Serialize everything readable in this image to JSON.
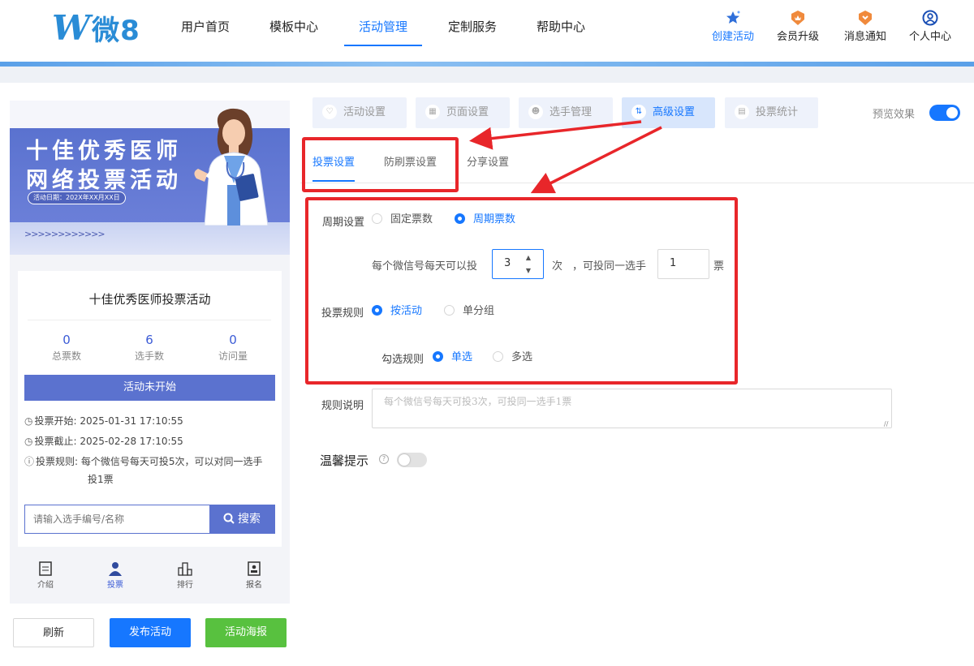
{
  "logo": {
    "mark": "W",
    "text": "微8"
  },
  "nav": [
    {
      "label": "用户首页"
    },
    {
      "label": "模板中心"
    },
    {
      "label": "活动管理",
      "active": true
    },
    {
      "label": "定制服务"
    },
    {
      "label": "帮助中心"
    }
  ],
  "tools": [
    {
      "label": "创建活动",
      "icon": "star-sparkle-icon"
    },
    {
      "label": "会员升级",
      "icon": "crown-badge-icon"
    },
    {
      "label": "消息通知",
      "icon": "bell-badge-icon"
    },
    {
      "label": "个人中心",
      "icon": "user-circle-icon"
    }
  ],
  "preview": {
    "banner_line1": "十佳优秀医师",
    "banner_line2": "网络投票活动",
    "banner_date": "活动日期：202X年XX月XX日",
    "banner_arrows": ">>>>>>>>>>>>",
    "title": "十佳优秀医师投票活动",
    "stats": [
      {
        "value": "0",
        "label": "总票数"
      },
      {
        "value": "6",
        "label": "选手数"
      },
      {
        "value": "0",
        "label": "访问量"
      }
    ],
    "status": "活动未开始",
    "start_label": "投票开始:",
    "start_value": "2025-01-31 17:10:55",
    "end_label": "投票截止:",
    "end_value": "2025-02-28 17:10:55",
    "rule_label": "投票规则:",
    "rule_value_line1": "每个微信号每天可投5次，可以对同一选手",
    "rule_value_line2": "投1票",
    "search_placeholder": "请输入选手编号/名称",
    "search_button": "搜索",
    "tabbar": [
      {
        "label": "介绍",
        "icon": "document-icon"
      },
      {
        "label": "投票",
        "icon": "person-icon",
        "active": true
      },
      {
        "label": "排行",
        "icon": "bar-chart-icon"
      },
      {
        "label": "报名",
        "icon": "id-card-icon"
      }
    ]
  },
  "actions": {
    "refresh": "刷新",
    "publish": "发布活动",
    "poster": "活动海报"
  },
  "steps": [
    {
      "label": "活动设置",
      "icon": "heart-icon"
    },
    {
      "label": "页面设置",
      "icon": "page-icon"
    },
    {
      "label": "选手管理",
      "icon": "person-icon"
    },
    {
      "label": "高级设置",
      "icon": "sliders-icon",
      "active": true
    },
    {
      "label": "投票统计",
      "icon": "chart-icon"
    }
  ],
  "preview_toggle": {
    "label": "预览效果",
    "on": true
  },
  "subtabs": [
    {
      "label": "投票设置",
      "active": true
    },
    {
      "label": "防刷票设置"
    },
    {
      "label": "分享设置"
    }
  ],
  "form": {
    "cycle_label": "周期设置",
    "cycle_options": [
      {
        "label": "固定票数",
        "checked": false
      },
      {
        "label": "周期票数",
        "checked": true
      }
    ],
    "per_day_prefix": "每个微信号每天可以投",
    "per_day_value": "3",
    "per_day_unit": "次",
    "same_player_prefix": "，可投同一选手",
    "same_player_value": "1",
    "same_player_unit": "票",
    "rule_label": "投票规则",
    "rule_options": [
      {
        "label": "按活动",
        "checked": true
      },
      {
        "label": "单分组",
        "checked": false
      }
    ],
    "check_label": "勾选规则",
    "check_options": [
      {
        "label": "单选",
        "checked": true
      },
      {
        "label": "多选",
        "checked": false
      }
    ],
    "desc_label": "规则说明",
    "desc_placeholder": "每个微信号每天可投3次，可投同一选手1票",
    "tip_label": "温馨提示",
    "tip_on": false
  },
  "colors": {
    "primary": "#1677ff",
    "preview_accent": "#5b72cf",
    "annotation": "#e8262a",
    "green": "#58c13f"
  }
}
